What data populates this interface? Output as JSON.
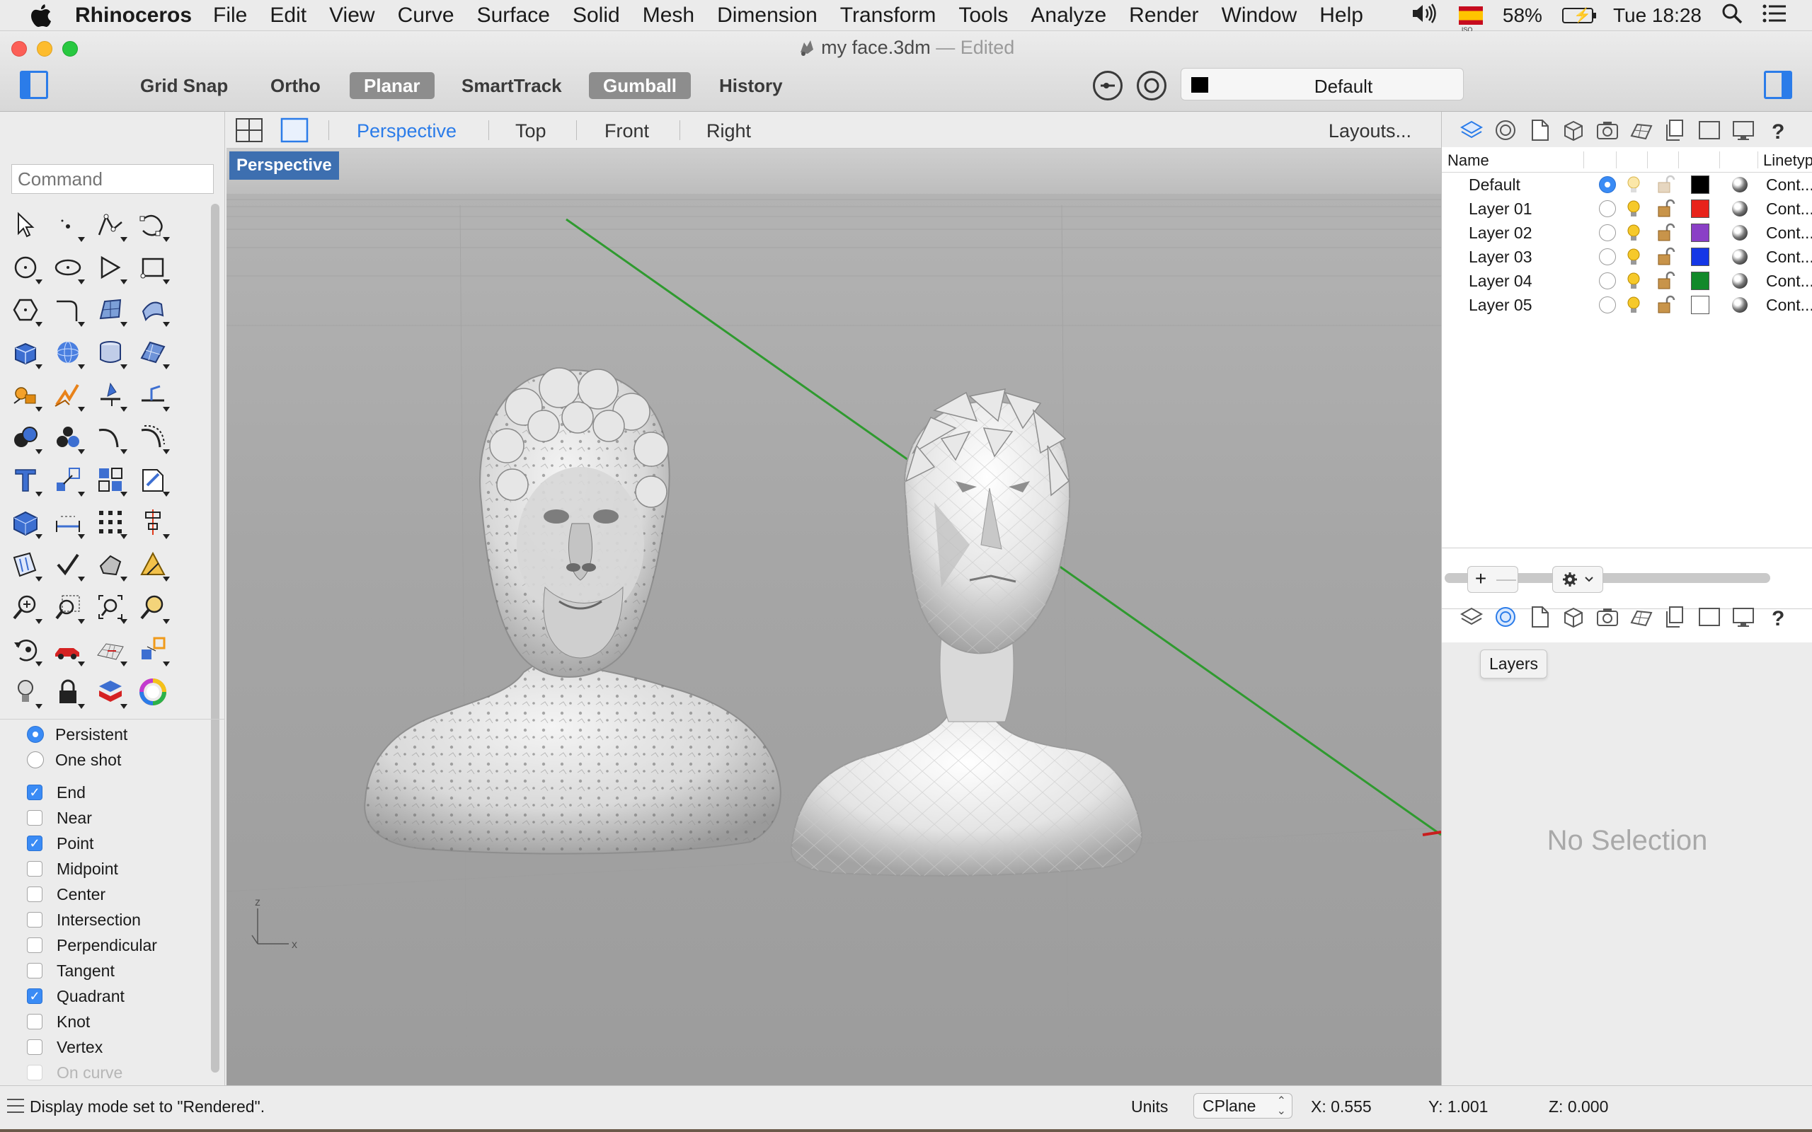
{
  "menubar": {
    "app_name": "Rhinoceros",
    "menus": [
      "File",
      "Edit",
      "View",
      "Curve",
      "Surface",
      "Solid",
      "Mesh",
      "Dimension",
      "Transform",
      "Tools",
      "Analyze",
      "Render",
      "Window",
      "Help"
    ],
    "flag_caption": "ISO",
    "battery": "58%",
    "clock": "Tue 18:28"
  },
  "window": {
    "title": "my face.3dm",
    "title_separator": "—",
    "state": "Edited"
  },
  "toolbar": {
    "grid_snap": "Grid Snap",
    "ortho": "Ortho",
    "planar": "Planar",
    "smarttrack": "SmartTrack",
    "gumball": "Gumball",
    "history": "History",
    "current_layer": "Default",
    "current_layer_color": "#000000"
  },
  "command": {
    "placeholder": "Command"
  },
  "viewport_tabs": {
    "tabs": [
      "Perspective",
      "Top",
      "Front",
      "Right"
    ],
    "active": "Perspective",
    "layouts": "Layouts..."
  },
  "viewport": {
    "label": "Perspective",
    "axis_z": "z",
    "axis_x": "x"
  },
  "osnaps": {
    "persistent": "Persistent",
    "one_shot": "One shot",
    "items": [
      {
        "label": "End",
        "checked": true
      },
      {
        "label": "Near",
        "checked": false
      },
      {
        "label": "Point",
        "checked": true
      },
      {
        "label": "Midpoint",
        "checked": false
      },
      {
        "label": "Center",
        "checked": false
      },
      {
        "label": "Intersection",
        "checked": false
      },
      {
        "label": "Perpendicular",
        "checked": false
      },
      {
        "label": "Tangent",
        "checked": false
      },
      {
        "label": "Quadrant",
        "checked": true
      },
      {
        "label": "Knot",
        "checked": false
      },
      {
        "label": "Vertex",
        "checked": false
      },
      {
        "label": "On curve",
        "checked": false
      }
    ]
  },
  "layers": {
    "col_name": "Name",
    "col_linetype": "Linetyp",
    "rows": [
      {
        "name": "Default",
        "color": "#000000",
        "linetype": "Cont...",
        "current": true
      },
      {
        "name": "Layer 01",
        "color": "#e8231b",
        "linetype": "Cont...",
        "current": false
      },
      {
        "name": "Layer 02",
        "color": "#8a3fc6",
        "linetype": "Cont...",
        "current": false
      },
      {
        "name": "Layer 03",
        "color": "#1537e6",
        "linetype": "Cont...",
        "current": false
      },
      {
        "name": "Layer 04",
        "color": "#12892a",
        "linetype": "Cont...",
        "current": false
      },
      {
        "name": "Layer 05",
        "color": "#ffffff",
        "linetype": "Cont...",
        "current": false
      }
    ],
    "add": "+",
    "remove": "—",
    "tooltip": "Layers",
    "no_selection": "No Selection"
  },
  "status": {
    "message": "Display mode set to \"Rendered\".",
    "units": "Units",
    "cplane": "CPlane",
    "x": "X: 0.555",
    "y": "Y: 1.001",
    "z": "Z: 0.000"
  },
  "colors": {
    "accent": "#2b7ce9",
    "viewport_bg": "#a3a3a3",
    "x_axis": "#c81e1e",
    "y_axis": "#2f9a2f"
  }
}
